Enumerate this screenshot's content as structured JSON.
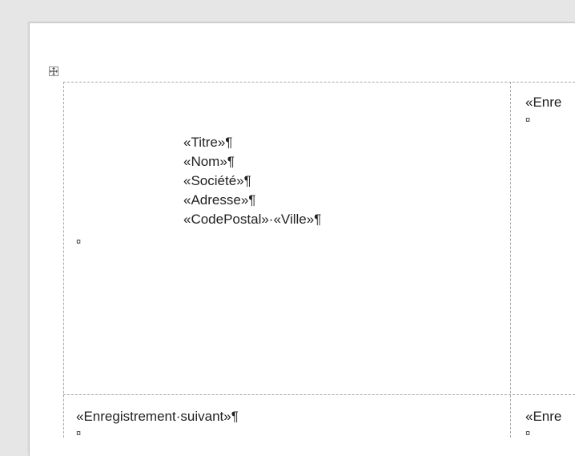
{
  "table_move_icon": "move-cross-icon",
  "cell_1": {
    "lines": [
      "«Titre»¶",
      "«Nom»¶",
      "«Société»¶",
      "«Adresse»¶",
      "«CodePostal»·«Ville»¶"
    ],
    "end_mark": "¤"
  },
  "cell_2": {
    "text": "«Enre",
    "end_mark": "¤"
  },
  "cell_3": {
    "text": "«Enregistrement·suivant»¶",
    "end_mark": "¤"
  },
  "cell_4": {
    "text": "«Enre",
    "end_mark": "¤"
  }
}
